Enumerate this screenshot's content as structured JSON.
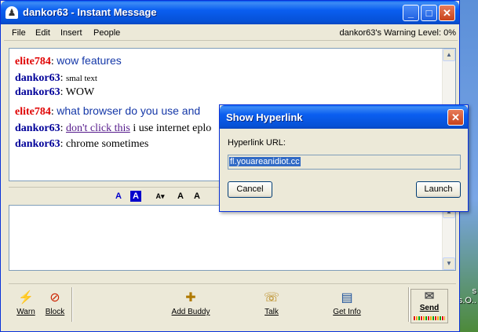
{
  "window": {
    "title": "dankor63 - Instant Message",
    "warning_level": "dankor63's Warning Level: 0%"
  },
  "menu": {
    "items": [
      {
        "label": "File"
      },
      {
        "label": "Edit"
      },
      {
        "label": "Insert"
      },
      {
        "label": "People"
      }
    ]
  },
  "conversation": {
    "messages": [
      {
        "sender": "elite784",
        "sep": ":",
        "text": "wow features",
        "sender_color": "red"
      },
      {
        "sender": "dankor63",
        "sep": ":",
        "text": "smal text",
        "sender_color": "blue"
      },
      {
        "sender": "dankor63",
        "sep": ":",
        "text": "WOW",
        "sender_color": "blue"
      },
      {
        "sender": "elite784",
        "sep": ":",
        "text": "what browser do you use and",
        "sender_color": "red"
      },
      {
        "sender": "dankor63",
        "sep": ":",
        "link": "don't click this",
        "text": "i use internet eplo",
        "sender_color": "blue"
      },
      {
        "sender": "dankor63",
        "sep": ":",
        "text": "chrome sometimes",
        "sender_color": "blue"
      }
    ]
  },
  "format_toolbar": {
    "buttons": [
      "A",
      "A",
      "A▾",
      "A",
      "A"
    ]
  },
  "toolbar": {
    "warn": "Warn",
    "block": "Block",
    "add_buddy": "Add Buddy",
    "talk": "Talk",
    "get_info": "Get Info",
    "send": "Send"
  },
  "dialog": {
    "title": "Show Hyperlink",
    "url_label": "Hyperlink URL:",
    "url_value": "fl.youareanidiot.cc",
    "cancel": "Cancel",
    "launch": "Launch"
  },
  "desktop": {
    "side_text_1": "s",
    "side_text_2": "s.O.."
  },
  "colors": {
    "sender_red": "#e00000",
    "sender_blue": "#000099",
    "titlebar": "#0a5ef0"
  },
  "icons": [
    "messenger-icon",
    "minimize-icon",
    "maximize-icon",
    "close-icon",
    "warn-icon",
    "block-icon",
    "add-buddy-icon",
    "talk-icon",
    "get-info-icon",
    "send-icon"
  ]
}
